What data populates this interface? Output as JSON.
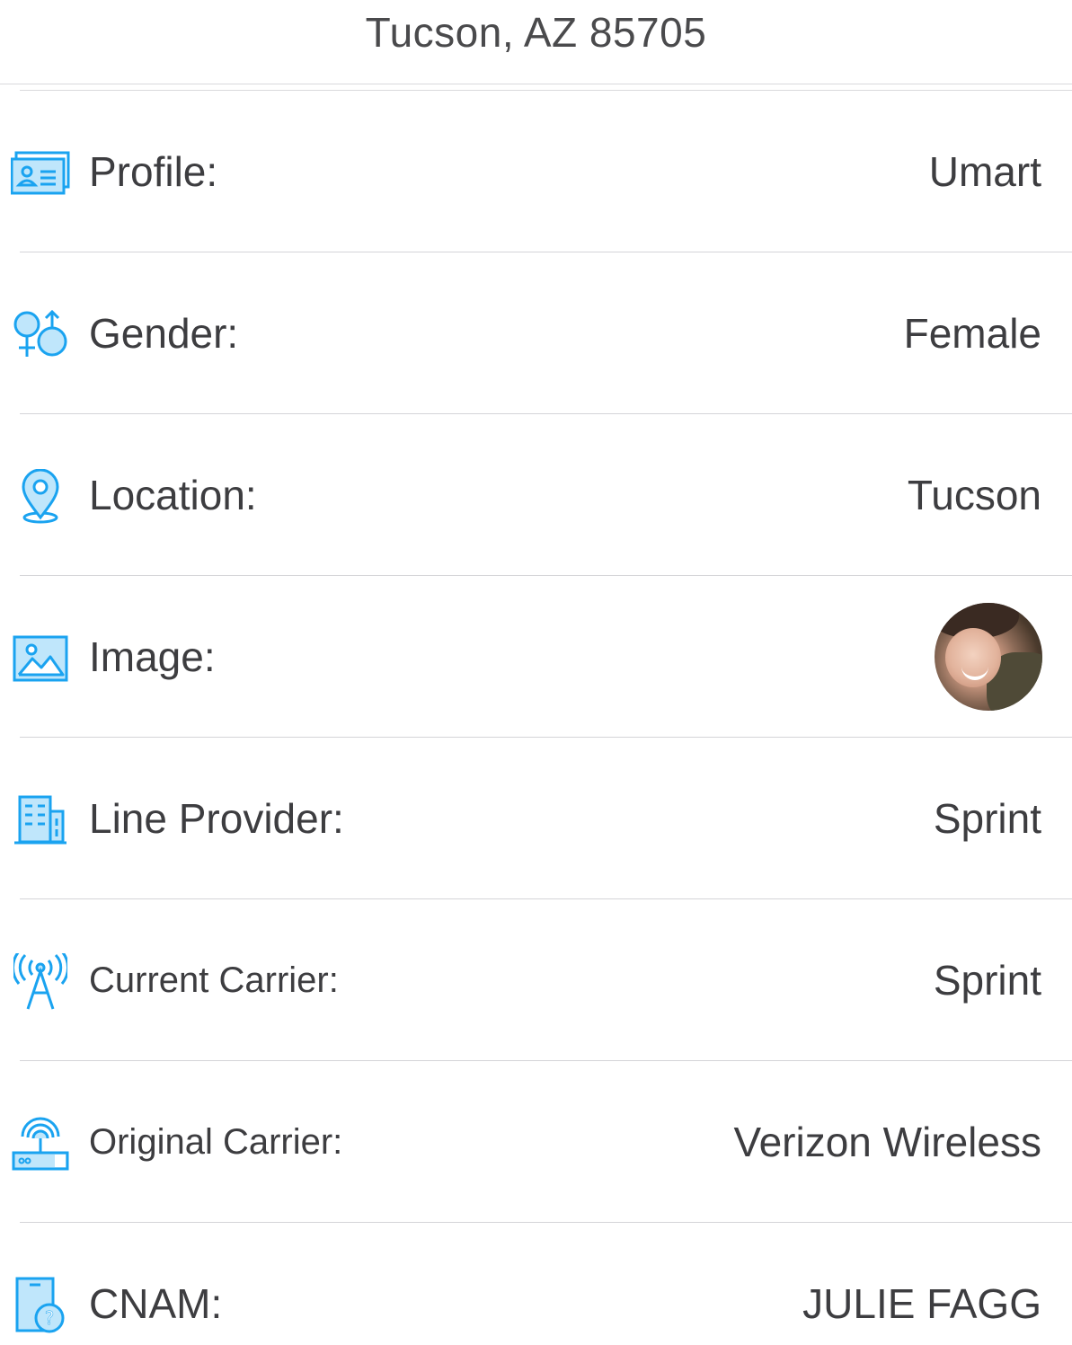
{
  "header": {
    "address": "Tucson, AZ 85705"
  },
  "colors": {
    "accent": "#1aa3f0",
    "icon_fill": "#bfe6fb",
    "text": "#3d3d40",
    "separator": "#d4d4d8"
  },
  "rows": [
    {
      "icon": "profile-card-icon",
      "label": "Profile:",
      "value": "Umart"
    },
    {
      "icon": "gender-icon",
      "label": "Gender:",
      "value": "Female"
    },
    {
      "icon": "location-pin-icon",
      "label": "Location:",
      "value": "Tucson"
    },
    {
      "icon": "image-icon",
      "label": "Image:",
      "value": ""
    },
    {
      "icon": "building-icon",
      "label": "Line Provider:",
      "value": "Sprint"
    },
    {
      "icon": "antenna-tower-icon",
      "label": "Current Carrier:",
      "value": "Sprint"
    },
    {
      "icon": "router-icon",
      "label": "Original Carrier:",
      "value": "Verizon Wireless"
    },
    {
      "icon": "phone-question-icon",
      "label": "CNAM:",
      "value": "JULIE FAGG"
    }
  ]
}
